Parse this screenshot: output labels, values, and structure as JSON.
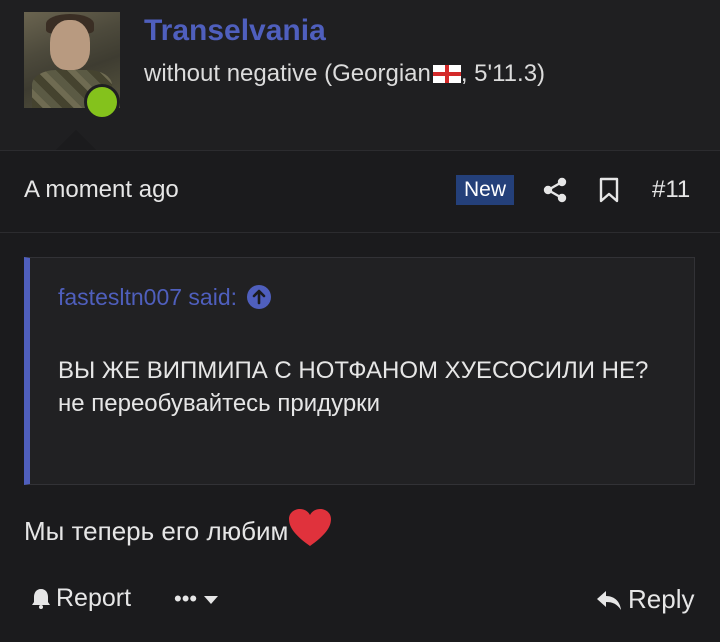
{
  "user": {
    "name": "Transelvania",
    "title_prefix": "without negative (Georgian",
    "title_suffix": ", 5'11.3)",
    "online": true
  },
  "meta": {
    "timestamp": "A moment ago",
    "badge": "New",
    "post_number": "#11"
  },
  "quote": {
    "author": "fastesltn007 said:",
    "lines": [
      "ВЫ ЖЕ ВИПМИПА С НОТФАНОМ ХУЕСОСИЛИ НЕ?",
      "не переобувайтесь придурки"
    ]
  },
  "message": {
    "text": "Мы теперь его любим"
  },
  "footer": {
    "report_label": "Report",
    "more_label": "•••",
    "reply_label": "Reply"
  },
  "icons": [
    "user-avatar",
    "online-indicator",
    "georgian-flag-icon",
    "share-icon",
    "bookmark-icon",
    "arrow-up-icon",
    "heart-icon",
    "warning-icon",
    "chevron-down-icon",
    "reply-icon"
  ],
  "colors": {
    "accent": "#4f5fbd",
    "badge": "#24407a",
    "online": "#84c21c",
    "heart": "#e0323c",
    "background": "#1b1b1d"
  }
}
